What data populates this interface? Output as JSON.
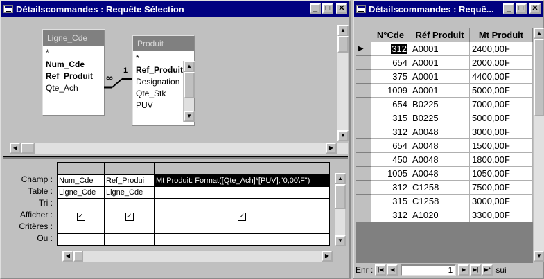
{
  "left_window": {
    "title": "Détailscommandes : Requête Sélection",
    "min": "_",
    "max": "□",
    "close": "✕",
    "tables": [
      {
        "name": "Ligne_Cde",
        "fields": [
          "*",
          "Num_Cde",
          "Ref_Produit",
          "Qte_Ach"
        ],
        "bold": [
          false,
          true,
          true,
          false
        ]
      },
      {
        "name": "Produit",
        "fields": [
          "*",
          "Ref_Produit",
          "Designation",
          "Qte_Stk",
          "PUV"
        ],
        "bold": [
          false,
          true,
          false,
          false,
          false
        ]
      }
    ],
    "join": {
      "left": "∞",
      "right": "1"
    },
    "grid": {
      "row_labels": [
        "Champ :",
        "Table :",
        "Tri :",
        "Afficher :",
        "Critères :",
        "Ou :"
      ],
      "columns": [
        {
          "champ": "Num_Cde",
          "table": "Ligne_Cde",
          "afficher": "✓"
        },
        {
          "champ": "Ref_Produi",
          "table": "Ligne_Cde",
          "afficher": "✓"
        },
        {
          "champ": "Mt Produit: Format([Qte_Ach]*[PUV];\"0,00\\F\")",
          "table": "",
          "afficher": "✓"
        }
      ]
    }
  },
  "right_window": {
    "title": "Détailscommandes : Requê...",
    "min": "_",
    "max": "□",
    "close": "✕",
    "headers": [
      "N°Cde",
      "Réf Produit",
      "Mt Produit"
    ],
    "rows": [
      [
        "312",
        "A0001",
        "2400,00F"
      ],
      [
        "654",
        "A0001",
        "2000,00F"
      ],
      [
        "375",
        "A0001",
        "4400,00F"
      ],
      [
        "1009",
        "A0001",
        "5000,00F"
      ],
      [
        "654",
        "B0225",
        "7000,00F"
      ],
      [
        "315",
        "B0225",
        "5000,00F"
      ],
      [
        "312",
        "A0048",
        "3000,00F"
      ],
      [
        "654",
        "A0048",
        "1500,00F"
      ],
      [
        "450",
        "A0048",
        "1800,00F"
      ],
      [
        "1005",
        "A0048",
        "1050,00F"
      ],
      [
        "312",
        "C1258",
        "7500,00F"
      ],
      [
        "315",
        "C1258",
        "3000,00F"
      ],
      [
        "312",
        "A1020",
        "3300,00F"
      ]
    ],
    "nav": {
      "label": "Enr :",
      "record": "1",
      "suffix": "sui"
    }
  }
}
